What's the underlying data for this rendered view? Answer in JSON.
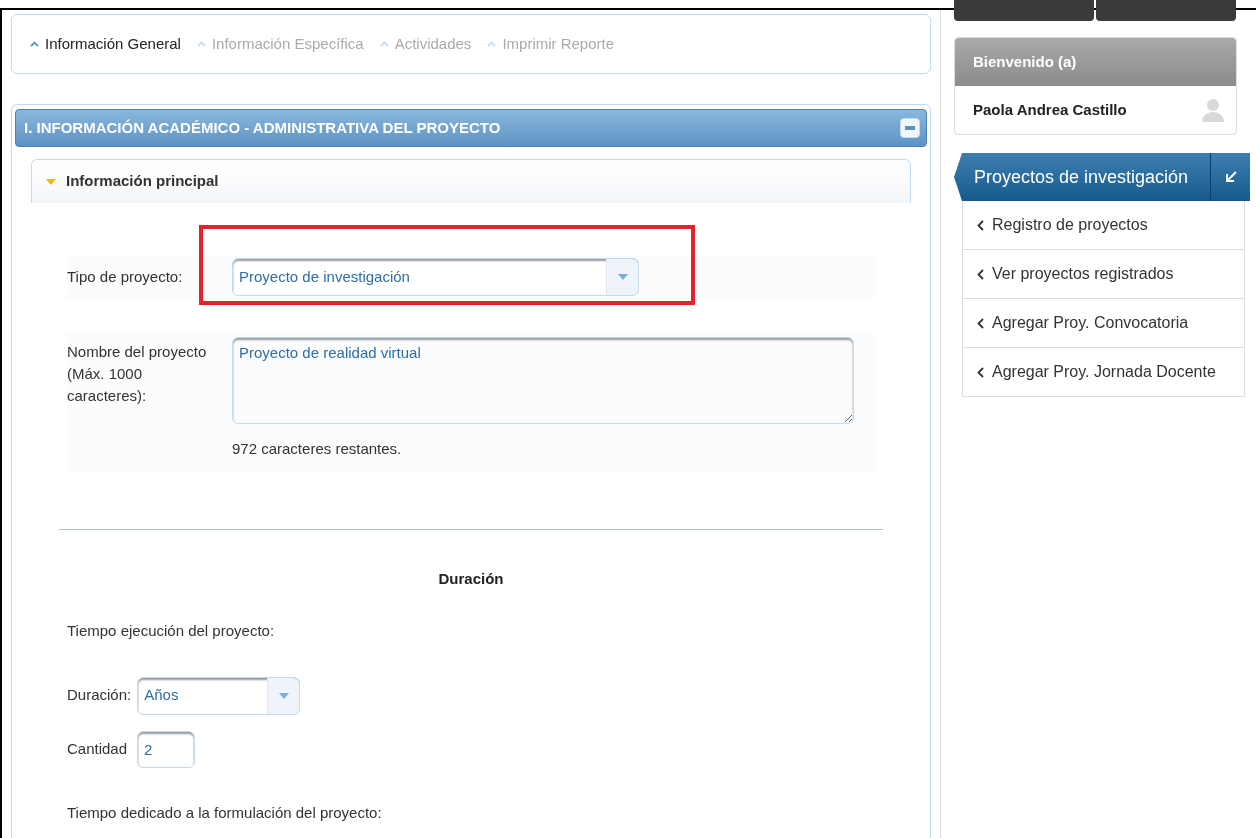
{
  "tabs": [
    {
      "label": "Información General",
      "selected": true
    },
    {
      "label": "Información Específica",
      "selected": false
    },
    {
      "label": "Actividades",
      "selected": false
    },
    {
      "label": "Imprimir Reporte",
      "selected": false
    }
  ],
  "section": {
    "title": "I. INFORMACIÓN ACADÉMICO - ADMINISTRATIVA DEL PROYECTO",
    "expanded": true
  },
  "panel": {
    "title": "Información principal",
    "expanded": true
  },
  "form": {
    "project_type": {
      "label": "Tipo de proyecto:",
      "value": "Proyecto de investigación",
      "highlighted": true
    },
    "project_name": {
      "label": "Nombre del proyecto (Máx. 1000 caracteres):",
      "value": "Proyecto de realidad virtual",
      "counter": "972 caracteres restantes."
    },
    "duration_heading": "Duración",
    "execution_time": "Tiempo ejecución del proyecto:",
    "duration": {
      "label": "Duración:",
      "value": "Años"
    },
    "quantity": {
      "label": "Cantidad",
      "value": "2"
    },
    "formulation_time": "Tiempo dedicado a la formulación del proyecto:"
  },
  "sidebar": {
    "welcome": "Bienvenido (a)",
    "user": "Paola Andrea Castillo",
    "menu_title": "Proyectos de investigación",
    "items": [
      "Registro de proyectos",
      "Ver proyectos registrados",
      "Agregar Proy. Convocatoria",
      "Agregar Proy. Jornada Docente"
    ]
  }
}
